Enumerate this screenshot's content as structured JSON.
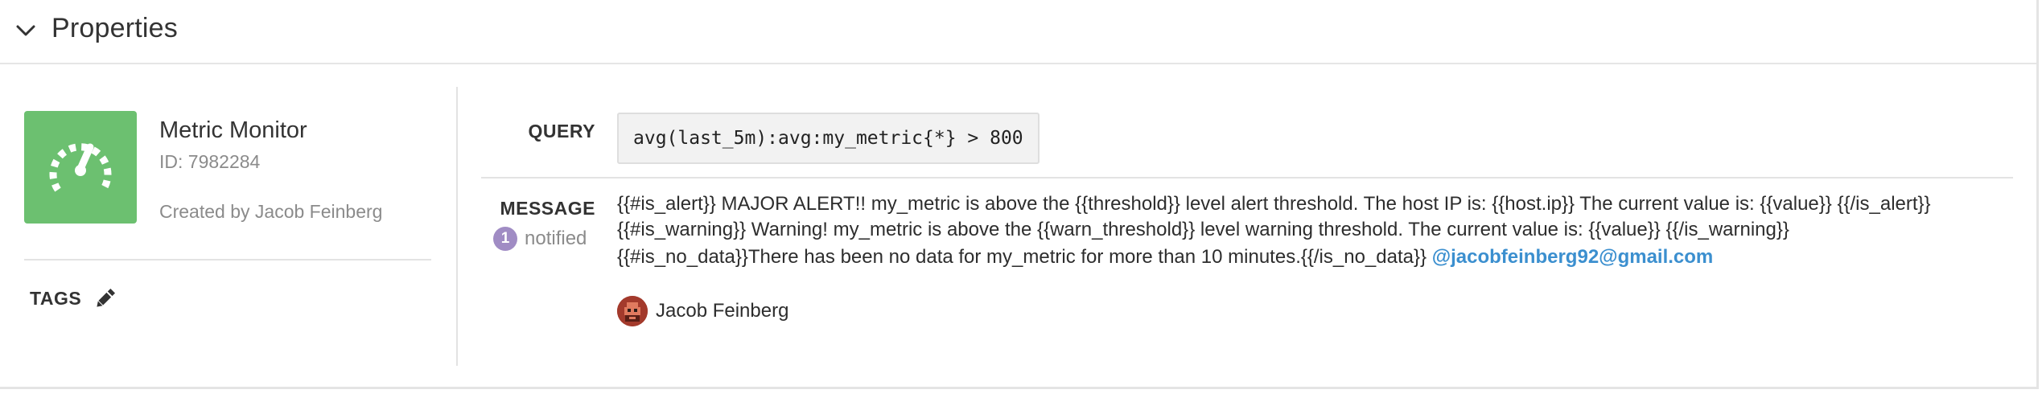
{
  "header": {
    "title": "Properties",
    "toggle_icon": "chevron-down-icon"
  },
  "monitor": {
    "icon": "speedometer-icon",
    "icon_color": "#6cc070",
    "name": "Metric Monitor",
    "id_text": "ID: 7982284",
    "created_by": "Created by Jacob Feinberg"
  },
  "tags": {
    "label": "TAGS",
    "edit_icon": "pencil-icon"
  },
  "query": {
    "label": "QUERY",
    "value": "avg(last_5m):avg:my_metric{*} > 800"
  },
  "message": {
    "label": "MESSAGE",
    "notified_count": "1",
    "notified_label": "notified",
    "badge_color": "#a08cc4",
    "line1": "{{#is_alert}} MAJOR ALERT!! my_metric is above the {{threshold}} level alert threshold. The host IP is: {{host.ip}} The current value is: {{value}} {{/is_alert}}",
    "line2": "{{#is_warning}} Warning! my_metric is above the {{warn_threshold}} level warning threshold. The current value is: {{value}} {{/is_warning}}",
    "line3_text": "{{#is_no_data}}There has been no data for my_metric for more than 10 minutes.{{/is_no_data}}",
    "line3_mention": "@jacobfeinberg92@gmail.com",
    "mention_color": "#3b8fcf"
  },
  "notified_users": [
    {
      "name": "Jacob Feinberg",
      "avatar": "avatar-pixel-icon"
    }
  ]
}
